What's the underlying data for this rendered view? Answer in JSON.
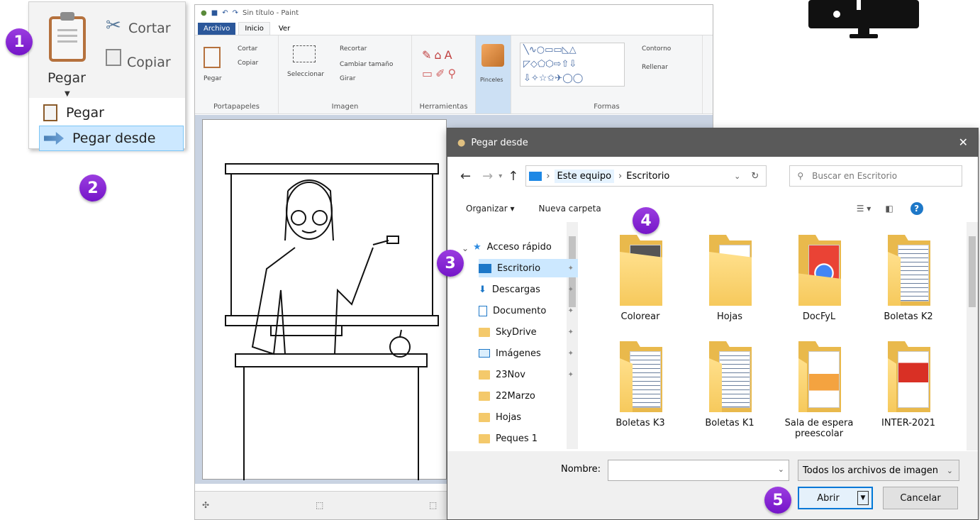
{
  "badges": [
    "1",
    "2",
    "3",
    "4",
    "5"
  ],
  "clipboard": {
    "pegar": "Pegar",
    "cortar": "Cortar",
    "copiar": "Copiar",
    "menu": [
      "Pegar",
      "Pegar desde"
    ]
  },
  "paint": {
    "title": "Sin título - Paint",
    "tabs": [
      "Archivo",
      "Inicio",
      "Ver"
    ],
    "groups": {
      "portapapeles": "Portapapeles",
      "imagen": "Imagen",
      "herramientas": "Herramientas",
      "formas": "Formas"
    },
    "labels": {
      "pegar": "Pegar",
      "cortar": "Cortar",
      "copiar": "Copiar",
      "seleccionar": "Seleccionar",
      "recortar": "Recortar",
      "cambiar": "Cambiar tamaño",
      "girar": "Girar",
      "pinceles": "Pinceles",
      "contorno": "Contorno",
      "rellenar": "Rellenar"
    }
  },
  "dialog": {
    "title": "Pegar desde",
    "breadcrumb": [
      "Este equipo",
      "Escritorio"
    ],
    "search_placeholder": "Buscar en Escritorio",
    "organizar": "Organizar ▾",
    "nueva_carpeta": "Nueva carpeta",
    "nav": [
      "Acceso rápido",
      "Escritorio",
      "Descargas",
      "Documento",
      "SkyDrive",
      "Imágenes",
      "23Nov",
      "22Marzo",
      "Hojas",
      "Peques 1"
    ],
    "files": [
      "Colorear",
      "Hojas",
      "DocFyL",
      "Boletas K2",
      "Boletas K3",
      "Boletas K1",
      "Sala de espera preescolar",
      "INTER-2021"
    ],
    "nombre_label": "Nombre:",
    "filter": "Todos los archivos de imagen",
    "abrir": "Abrir",
    "cancelar": "Cancelar"
  },
  "colors": {
    "accent": "#7b22cc",
    "selected": "#cce8ff",
    "paintTab": "#2b579a"
  }
}
